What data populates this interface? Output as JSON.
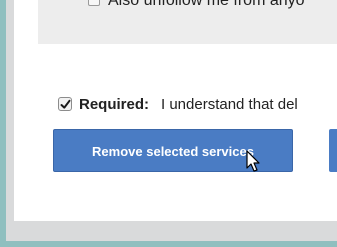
{
  "unfollow": {
    "label": "Also unfollow me from anyo",
    "checked": false
  },
  "required": {
    "strong_label": "Required:",
    "text": "I understand that del",
    "checked": true
  },
  "actions": {
    "remove_label": "Remove selected services"
  },
  "colors": {
    "button": "#4a7cc4",
    "background": "#8fbfbf",
    "panel": "#ffffff"
  },
  "icons": {
    "checkbox": "checkmark-icon",
    "cursor": "pointer-cursor-icon"
  }
}
